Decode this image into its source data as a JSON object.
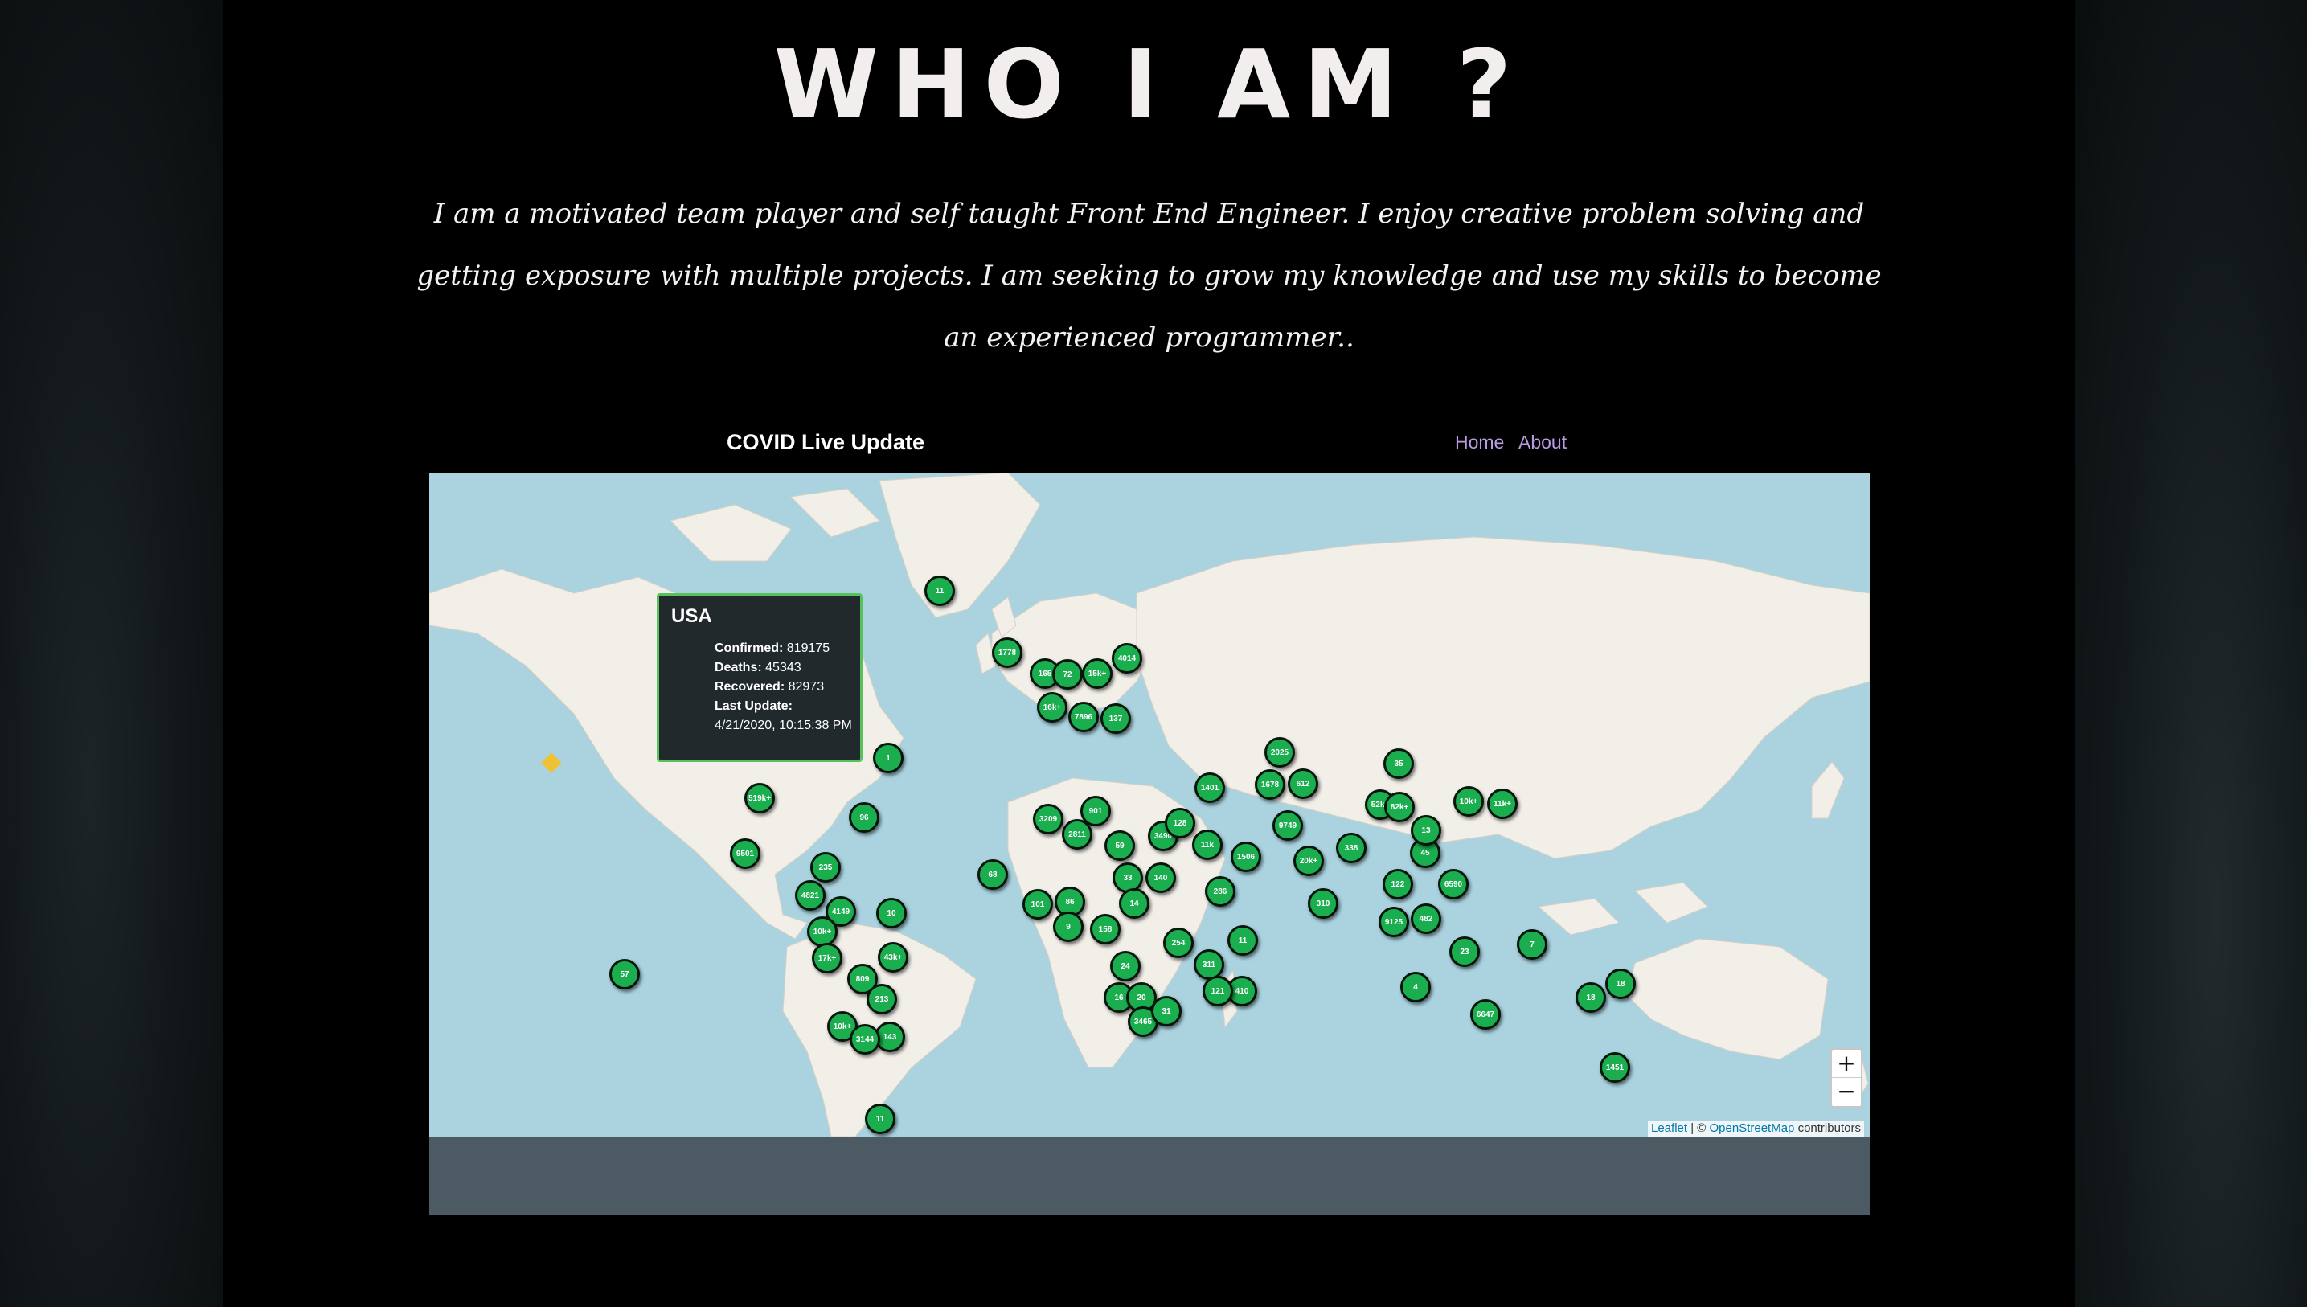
{
  "title": "WHO I AM ?",
  "bio": "I am a motivated team player and self taught Front End Engineer. I enjoy creative problem solving and getting exposure with multiple projects. I am seeking to grow my knowledge and use my skills to become an experienced programmer..",
  "app": {
    "brand": "COVID Live Update",
    "nav": [
      "Home",
      "About"
    ],
    "popup": {
      "country": "USA",
      "confirmed_label": "Confirmed:",
      "confirmed": "819175",
      "deaths_label": "Deaths:",
      "deaths": "45343",
      "recovered_label": "Recovered:",
      "recovered": "82973",
      "last_update_label": "Last Update:",
      "last_update": "4/21/2020, 10:15:38 PM"
    },
    "zoom": {
      "in": "+",
      "out": "−"
    },
    "attribution": {
      "leaflet": "Leaflet",
      "sep": " | © ",
      "osm": "OpenStreetMap",
      "suffix": " contributors"
    },
    "marker_labels": [
      "11",
      "1778",
      "165",
      "72",
      "15k+",
      "4014",
      "16k+",
      "7896",
      "137",
      "2025",
      "52k+",
      "1",
      "519k+",
      "96",
      "9501",
      "235",
      "1678",
      "612",
      "35",
      "1401",
      "82k+",
      "10k+",
      "11k+",
      "3209",
      "901",
      "2811",
      "3490",
      "9749",
      "128",
      "59",
      "11k",
      "1506",
      "20k+",
      "338",
      "45",
      "6590",
      "68",
      "33",
      "140",
      "286",
      "101",
      "86",
      "14",
      "310",
      "122",
      "10",
      "4149",
      "4821",
      "9125",
      "482",
      "10k+",
      "17k+",
      "24",
      "254",
      "311",
      "11",
      "43k+",
      "57",
      "809",
      "213",
      "16",
      "20",
      "410",
      "121",
      "7",
      "3465",
      "31",
      "6647",
      "18",
      "18",
      "10k+",
      "143",
      "3144",
      "1451",
      "11",
      "158",
      "9",
      "23",
      "4",
      "13"
    ],
    "colors": {
      "marker": "#1aae4f",
      "popup_bg": "#22292d",
      "popup_border": "#59c15c",
      "ocean": "#aad3df",
      "land": "#f2efe9",
      "nav_link": "#b99be4"
    }
  }
}
